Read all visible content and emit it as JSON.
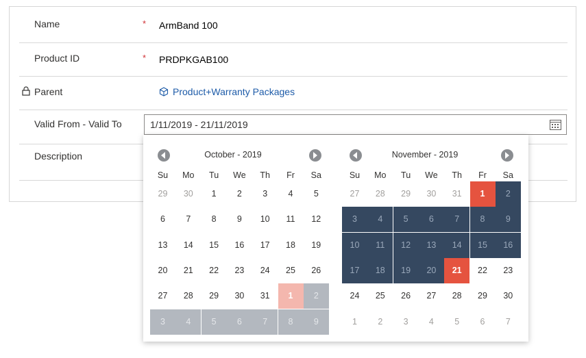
{
  "form": {
    "name": {
      "label": "Name",
      "required": "*",
      "value": "ArmBand 100"
    },
    "product_id": {
      "label": "Product ID",
      "required": "*",
      "value": "PRDPKGAB100"
    },
    "parent": {
      "label": "Parent",
      "value": "Product+Warranty Packages"
    },
    "valid": {
      "label": "Valid From - Valid To",
      "value": "1/11/2019 - 21/11/2019"
    },
    "description": {
      "label": "Description"
    }
  },
  "calendar": {
    "weekdays": [
      "Su",
      "Mo",
      "Tu",
      "We",
      "Th",
      "Fr",
      "Sa"
    ],
    "months": [
      {
        "title": "October - 2019",
        "days": [
          [
            "29",
            "o"
          ],
          [
            "30",
            "o"
          ],
          [
            "1",
            ""
          ],
          [
            "2",
            ""
          ],
          [
            "3",
            ""
          ],
          [
            "4",
            ""
          ],
          [
            "5",
            ""
          ],
          [
            "6",
            ""
          ],
          [
            "7",
            ""
          ],
          [
            "8",
            ""
          ],
          [
            "9",
            ""
          ],
          [
            "10",
            ""
          ],
          [
            "11",
            ""
          ],
          [
            "12",
            ""
          ],
          [
            "13",
            ""
          ],
          [
            "14",
            ""
          ],
          [
            "15",
            ""
          ],
          [
            "16",
            ""
          ],
          [
            "17",
            ""
          ],
          [
            "18",
            ""
          ],
          [
            "19",
            ""
          ],
          [
            "20",
            ""
          ],
          [
            "21",
            ""
          ],
          [
            "22",
            ""
          ],
          [
            "23",
            ""
          ],
          [
            "24",
            ""
          ],
          [
            "25",
            ""
          ],
          [
            "26",
            ""
          ],
          [
            "27",
            ""
          ],
          [
            "28",
            ""
          ],
          [
            "29",
            ""
          ],
          [
            "30",
            ""
          ],
          [
            "31",
            ""
          ],
          [
            "1",
            "ps"
          ],
          [
            "2",
            "pr"
          ],
          [
            "3",
            "pr"
          ],
          [
            "4",
            "pr"
          ],
          [
            "5",
            "pr"
          ],
          [
            "6",
            "pr"
          ],
          [
            "7",
            "pr"
          ],
          [
            "8",
            "pr"
          ],
          [
            "9",
            "pr"
          ]
        ]
      },
      {
        "title": "November - 2019",
        "days": [
          [
            "27",
            "o"
          ],
          [
            "28",
            "o"
          ],
          [
            "29",
            "o"
          ],
          [
            "30",
            "o"
          ],
          [
            "31",
            "o"
          ],
          [
            "1",
            "e"
          ],
          [
            "2",
            "r"
          ],
          [
            "3",
            "r"
          ],
          [
            "4",
            "r"
          ],
          [
            "5",
            "r"
          ],
          [
            "6",
            "r"
          ],
          [
            "7",
            "r"
          ],
          [
            "8",
            "r"
          ],
          [
            "9",
            "r"
          ],
          [
            "10",
            "r"
          ],
          [
            "11",
            "r"
          ],
          [
            "12",
            "r"
          ],
          [
            "13",
            "r"
          ],
          [
            "14",
            "r"
          ],
          [
            "15",
            "r"
          ],
          [
            "16",
            "r"
          ],
          [
            "17",
            "r"
          ],
          [
            "18",
            "r"
          ],
          [
            "19",
            "r"
          ],
          [
            "20",
            "r"
          ],
          [
            "21",
            "e"
          ],
          [
            "22",
            ""
          ],
          [
            "23",
            ""
          ],
          [
            "24",
            ""
          ],
          [
            "25",
            ""
          ],
          [
            "26",
            ""
          ],
          [
            "27",
            ""
          ],
          [
            "28",
            ""
          ],
          [
            "29",
            ""
          ],
          [
            "30",
            ""
          ],
          [
            "1",
            "o"
          ],
          [
            "2",
            "o"
          ],
          [
            "3",
            "o"
          ],
          [
            "4",
            "o"
          ],
          [
            "5",
            "o"
          ],
          [
            "6",
            "o"
          ],
          [
            "7",
            "o"
          ]
        ]
      }
    ]
  }
}
